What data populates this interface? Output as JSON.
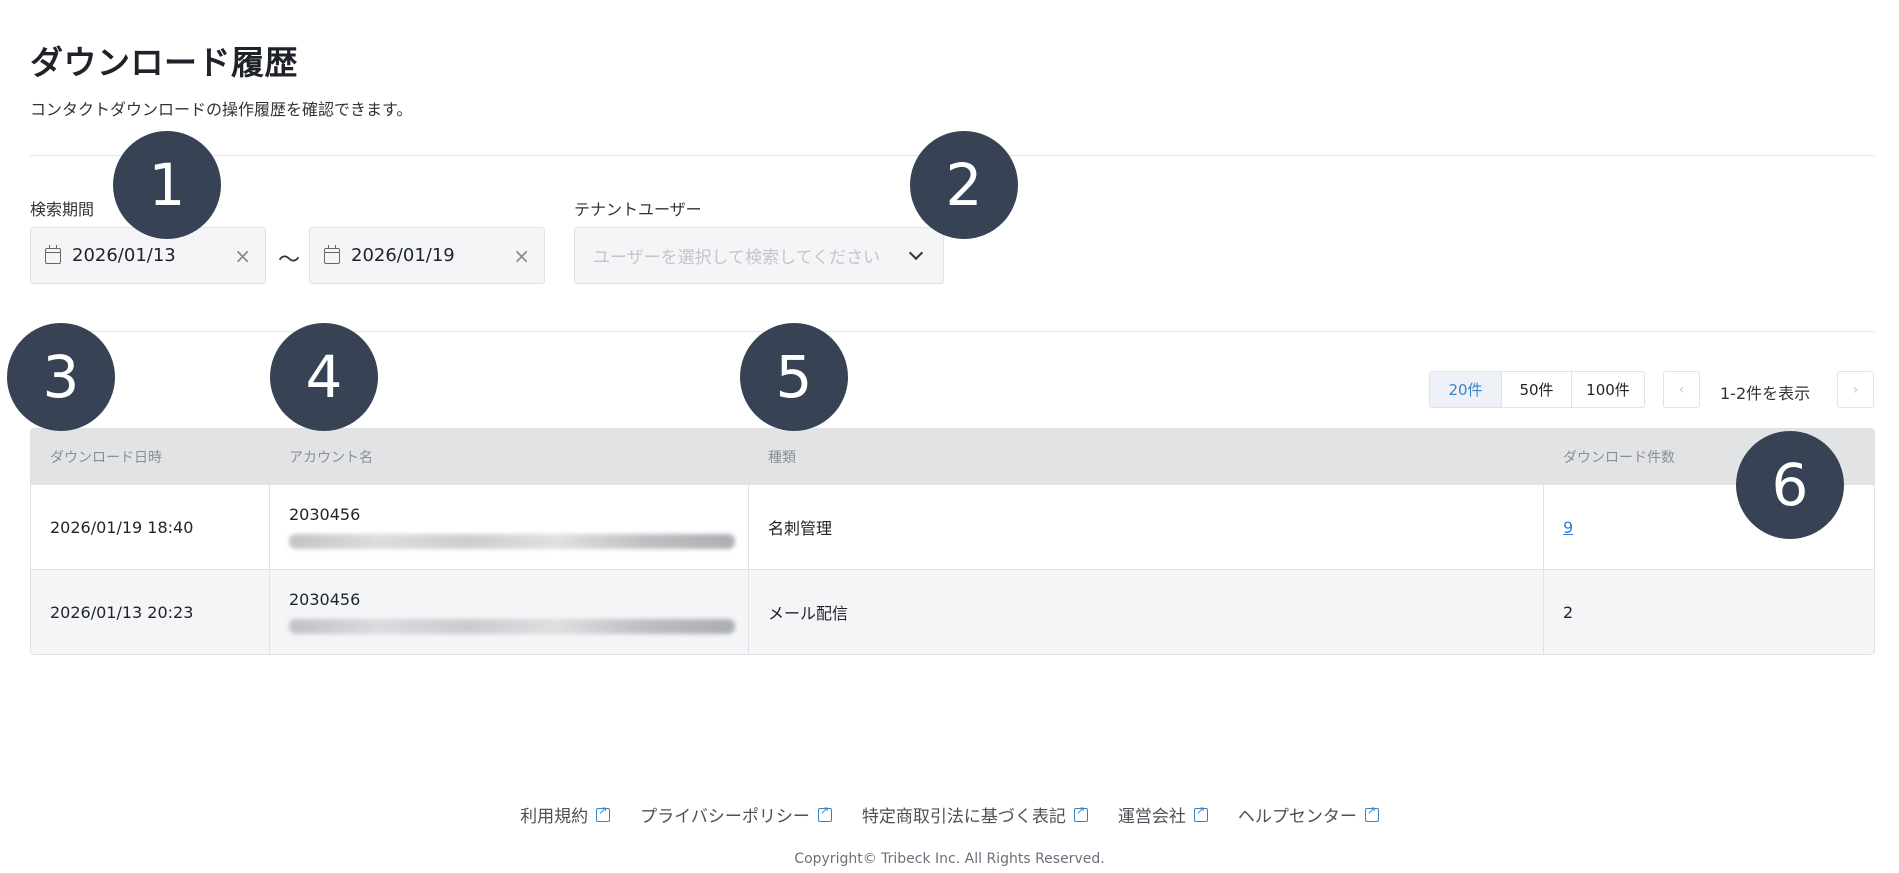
{
  "header": {
    "title": "ダウンロード履歴",
    "subtitle": "コンタクトダウンロードの操作履歴を確認できます。"
  },
  "filters": {
    "period_label": "検索期間",
    "start_date": "2026/01/13",
    "end_date": "2026/01/19",
    "separator": "〜",
    "tenant_label": "テナントユーザー",
    "tenant_placeholder": "ユーザーを選択して検索してください"
  },
  "pagination": {
    "page_sizes": [
      "20件",
      "50件",
      "100件"
    ],
    "selected_size": "20件",
    "range_text": "1-2件を表示"
  },
  "table": {
    "columns": [
      "ダウンロード日時",
      "アカウント名",
      "種類",
      "ダウンロード件数"
    ],
    "rows": [
      {
        "datetime": "2026/01/19 18:40",
        "account_id": "2030456",
        "type": "名刺管理",
        "count": "9"
      },
      {
        "datetime": "2026/01/13 20:23",
        "account_id": "2030456",
        "type": "メール配信",
        "count": "2"
      }
    ]
  },
  "badges": [
    "1",
    "2",
    "3",
    "4",
    "5",
    "6"
  ],
  "footer": {
    "links": [
      "利用規約",
      "プライバシーポリシー",
      "特定商取引法に基づく表記",
      "運営会社",
      "ヘルプセンター"
    ],
    "copyright": "Copyright© Tribeck Inc. All Rights Reserved."
  },
  "colors": {
    "badge": "#374355",
    "link": "#2f7fd6",
    "table_header": "#e2e3e5"
  },
  "icons": {
    "date_input": "calendar-icon",
    "clear": "close-icon",
    "select": "chevron-down-icon",
    "footer_link": "external-link-icon"
  }
}
